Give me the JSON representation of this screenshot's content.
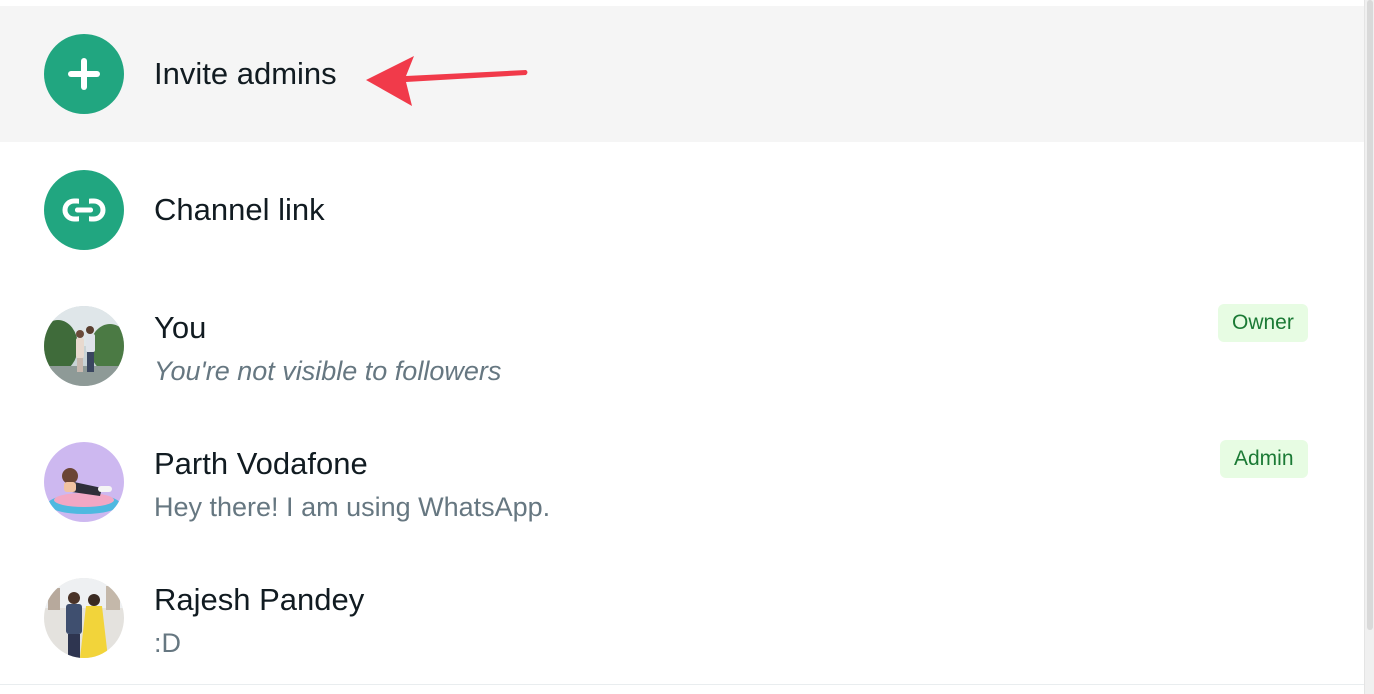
{
  "rows": [
    {
      "type": "action",
      "icon": "plus-icon",
      "title": "Invite admins"
    },
    {
      "type": "action",
      "icon": "link-icon",
      "title": "Channel link"
    },
    {
      "type": "member",
      "title": "You",
      "subtitle": "You're not visible to followers",
      "badge": "Owner"
    },
    {
      "type": "member",
      "title": "Parth Vodafone",
      "subtitle": "Hey there! I am using WhatsApp.",
      "badge": "Admin"
    },
    {
      "type": "member",
      "title": "Rajesh Pandey",
      "subtitle": ":D"
    }
  ],
  "colors": {
    "accent": "#21a680",
    "badge_bg": "#e7fce3",
    "badge_text": "#1b7a35",
    "annotation_arrow": "#f13a4a"
  }
}
